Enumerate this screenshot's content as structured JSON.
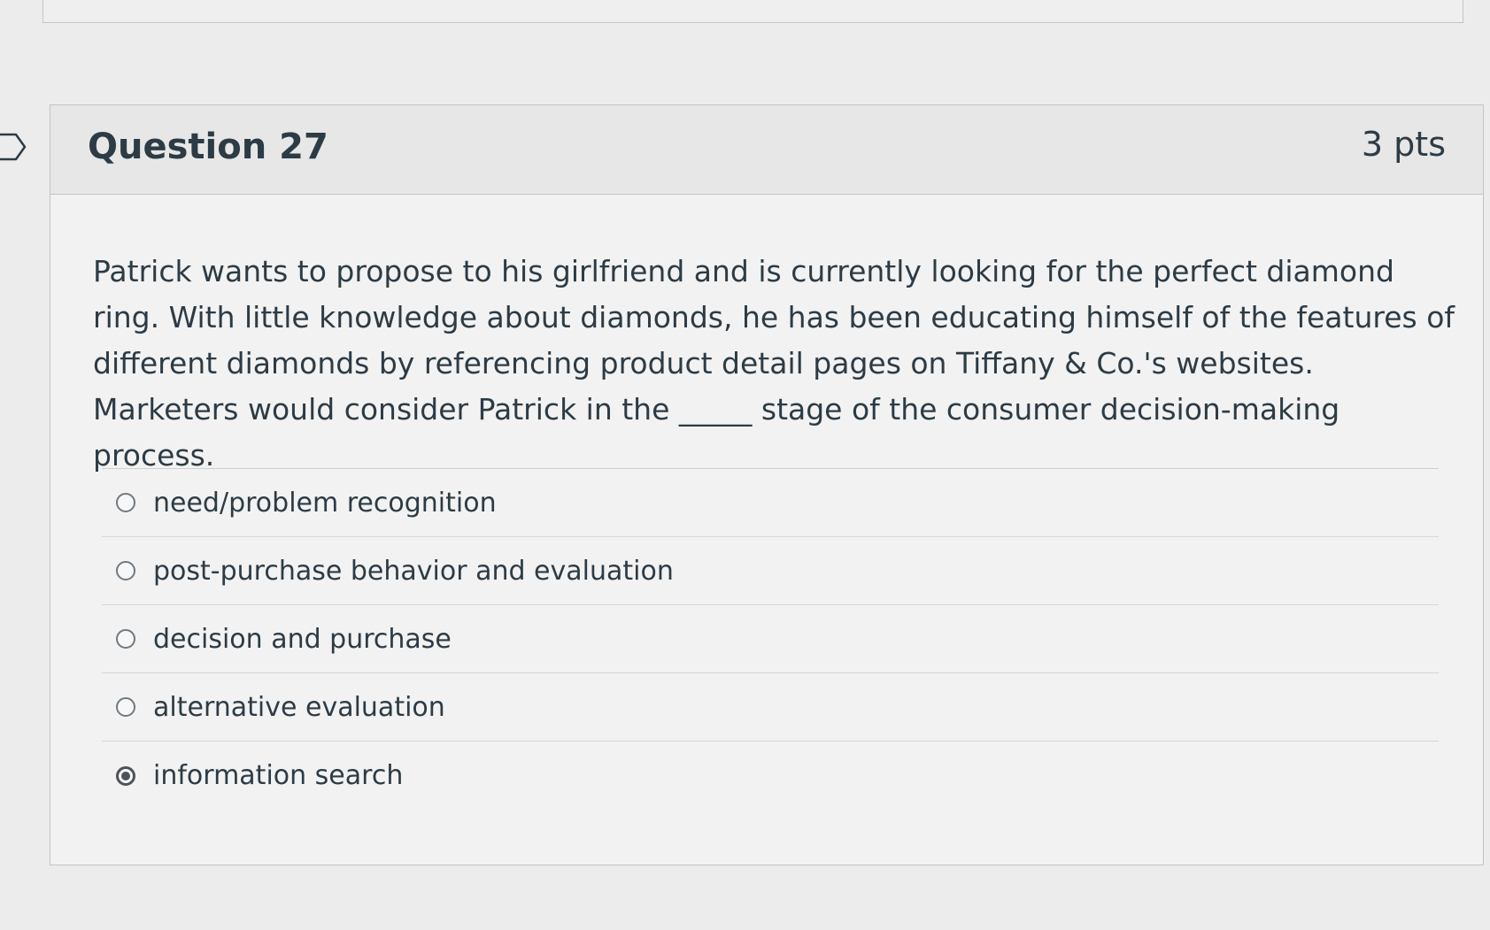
{
  "question": {
    "title": "Question 27",
    "points": "3 pts",
    "text": "Patrick wants to propose to his girlfriend and is currently looking for the perfect diamond ring. With little knowledge about diamonds, he has been educating himself of the features of different diamonds by referencing product detail pages on Tiffany & Co.'s websites. Marketers would consider Patrick in the _____ stage of the consumer decision-making process."
  },
  "answers": [
    {
      "label": "need/problem recognition",
      "selected": false
    },
    {
      "label": "post-purchase behavior and evaluation",
      "selected": false
    },
    {
      "label": "decision and purchase",
      "selected": false
    },
    {
      "label": "alternative evaluation",
      "selected": false
    },
    {
      "label": "information search",
      "selected": true
    }
  ],
  "icons": {
    "flag": "flag-outline-icon",
    "radio_empty": "radio-empty-icon",
    "radio_selected": "radio-selected-icon"
  }
}
